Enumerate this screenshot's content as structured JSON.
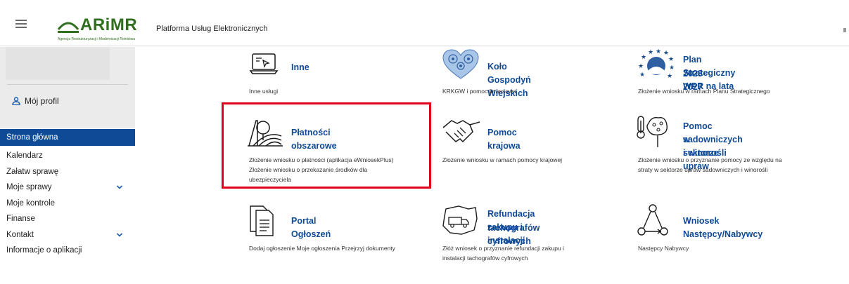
{
  "header": {
    "logo_text": "ARiMR",
    "logo_subtext": "Agencja Restrukturyzacji i Modernizacji Rolnictwa",
    "platform_title": "Platforma Usług Elektronicznych"
  },
  "sidebar": {
    "profile_label": "Mój profil",
    "items": [
      {
        "label": "Strona główna"
      },
      {
        "label": "Kalendarz"
      },
      {
        "label": "Załatw sprawę"
      },
      {
        "label": "Moje sprawy"
      },
      {
        "label": "Moje kontrole"
      },
      {
        "label": "Finanse"
      },
      {
        "label": "Kontakt"
      },
      {
        "label": "Informacje o aplikacji"
      }
    ]
  },
  "tiles": [
    {
      "title": "Inne",
      "desc": "Inne usługi",
      "icon": "laptop-cursor-icon"
    },
    {
      "title": "Koło Gospodyń Wiejskich",
      "desc": "KRKGW i pomoc finansowa",
      "icon": "folk-heart-icon"
    },
    {
      "title_line1": "Plan Strategiczny WPR na lata",
      "title_line2": "2023-2027",
      "desc": "Złożenie wniosku w ramach Planu Strategicznego",
      "icon": "eu-stars-field-icon"
    },
    {
      "title": "Płatności obszarowe",
      "desc_line1": "Złożenie wniosku o płatności (aplikacja eWniosekPlus)",
      "desc_line2": "Złożenie wniosku o przekazanie środków dla",
      "desc_line3": "ubezpieczyciela",
      "icon": "tree-field-icon"
    },
    {
      "title": "Pomoc krajowa",
      "desc": "Złożenie wniosku w ramach pomocy krajowej",
      "icon": "handshake-icon"
    },
    {
      "title_line1": "Pomoc w sektorze upraw",
      "title_line2": "sadowniczych i winorośli",
      "desc_line1": "Złożenie wniosku o przyznanie pomocy ze względu na",
      "desc_line2": "straty w sektorze upraw sadowniczych i winorośli",
      "icon": "thermometer-tree-icon"
    },
    {
      "title": "Portal Ogłoszeń",
      "desc": "Dodaj ogłoszenie Moje ogłoszenia Przejrzyj dokumenty",
      "icon": "documents-icon"
    },
    {
      "title_line1": "Refundacja zakupu i instalacji",
      "title_line2": "tachografów cyfrowych",
      "desc_line1": "Złóż wniosek o przyznanie refundacji zakupu i",
      "desc_line2": "instalacji tachografów cyfrowych",
      "icon": "truck-map-icon"
    },
    {
      "title": "Wniosek Następcy/Nabywcy",
      "desc": "Następcy Nabywcy",
      "icon": "triangle-nodes-icon"
    }
  ],
  "colors": {
    "primary": "#0f4a96",
    "logo_green": "#2f6f1e",
    "highlight": "#e0001b"
  }
}
